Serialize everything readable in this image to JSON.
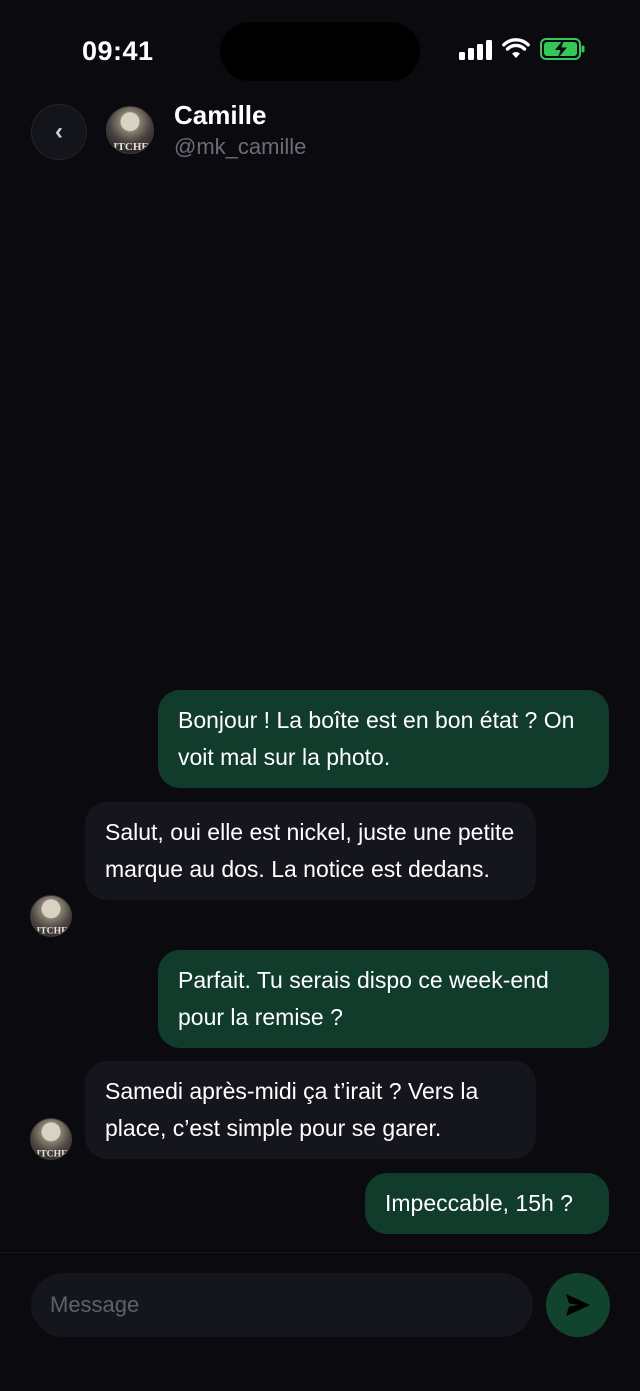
{
  "status_bar": {
    "time": "09:41",
    "icons": [
      "signal-icon",
      "wifi-icon",
      "battery-charging-icon"
    ],
    "battery_color": "#34c759"
  },
  "header": {
    "back_icon": "chevron-left-icon",
    "back_glyph": "‹",
    "contact_name": "Camille",
    "contact_handle": "@mk_camille",
    "avatar_text": "ITCHE"
  },
  "messages": [
    {
      "direction": "out",
      "text": "Bonjour ! La boîte est en bon état ? On voit mal sur la photo."
    },
    {
      "direction": "in",
      "text": "Salut, oui elle est nickel, juste une petite marque au dos. La notice est dedans."
    },
    {
      "direction": "out",
      "text": "Parfait. Tu serais dispo ce week-end pour la remise ?"
    },
    {
      "direction": "in",
      "text": "Samedi après-midi ça t’irait ? Vers la place, c’est simple pour se garer."
    },
    {
      "direction": "out",
      "text": "Impeccable, 15h ?"
    }
  ],
  "composer": {
    "placeholder": "Message",
    "value": "",
    "send_icon": "send-icon"
  },
  "colors": {
    "background": "#0a0a0f",
    "outgoing_bubble": "#113b2b",
    "incoming_bubble": "#15151d",
    "send_button": "#12432f",
    "handle_text": "#6b6c78"
  }
}
